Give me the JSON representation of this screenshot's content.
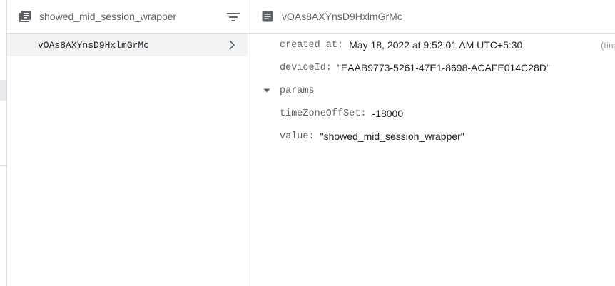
{
  "collection": {
    "name": "showed_mid_session_wrapper",
    "icon": "collection-icon",
    "filter_icon": "filter-icon",
    "documents": [
      {
        "id": "vOAs8AXYnsD9HxlmGrMc",
        "selected": true
      }
    ]
  },
  "document": {
    "id": "vOAs8AXYnsD9HxlmGrMc",
    "icon": "document-icon",
    "fields": {
      "created_at": {
        "key": "created_at:",
        "value": "May 18, 2022 at 9:52:01 AM UTC+5:30",
        "type_hint": "(timestamp)"
      },
      "deviceId": {
        "key": "deviceId:",
        "value": "\"EAAB9773-5261-47E1-8698-ACAFE014C28D\""
      },
      "params": {
        "key": "params",
        "expanded": true,
        "children": {
          "timeZoneOffSet": {
            "key": "timeZoneOffSet:",
            "value": "-18000"
          },
          "value": {
            "key": "value:",
            "value": "\"showed_mid_session_wrapper\""
          }
        }
      }
    }
  },
  "colors": {
    "border": "#dadce0",
    "selected_row": "#f1f3f4",
    "muted_text": "#5f6368",
    "text": "#202124"
  }
}
